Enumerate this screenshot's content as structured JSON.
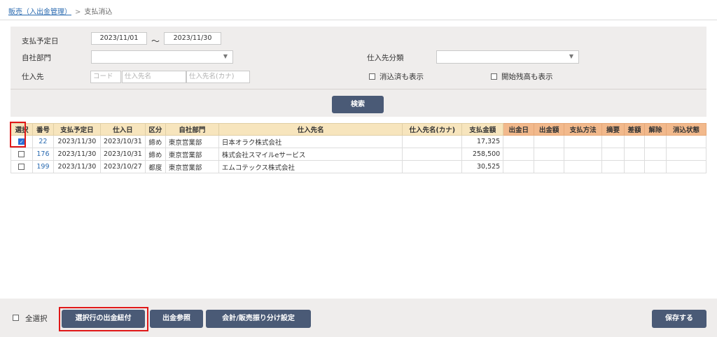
{
  "breadcrumb": {
    "parent": "販売（入出金管理）",
    "separator": ">",
    "current": "支払消込"
  },
  "search": {
    "due_date_label": "支払予定日",
    "date_from": "2023/11/01",
    "date_to": "2023/11/30",
    "tilde": "～",
    "department_label": "自社部門",
    "department_value": "",
    "supplier_class_label": "仕入先分類",
    "supplier_class_value": "",
    "supplier_label": "仕入先",
    "code_placeholder": "コード",
    "name_placeholder": "仕入先名",
    "kana_placeholder": "仕入先名(カナ)",
    "show_cleared_label": "消込済も表示",
    "show_opening_label": "開始残高も表示",
    "search_button": "検索"
  },
  "table": {
    "headers": {
      "select": "選択",
      "number": "番号",
      "due_date": "支払予定日",
      "purchase_date": "仕入日",
      "category": "区分",
      "department": "自社部門",
      "supplier": "仕入先名",
      "supplier_kana": "仕入先名(カナ)",
      "amount": "支払金額",
      "pay_date": "出金日",
      "pay_amount": "出金額",
      "pay_method": "支払方法",
      "memo": "摘要",
      "diff": "差額",
      "cancel": "解除",
      "status": "消込状態"
    },
    "rows": [
      {
        "checked": true,
        "number": "22",
        "due_date": "2023/11/30",
        "purchase_date": "2023/10/31",
        "category": "締め",
        "department": "東京営業部",
        "supplier": "日本オラク株式会社",
        "supplier_kana": "",
        "amount": "17,325"
      },
      {
        "checked": false,
        "number": "176",
        "due_date": "2023/11/30",
        "purchase_date": "2023/10/31",
        "category": "締め",
        "department": "東京営業部",
        "supplier": "株式会社スマイルeサービス",
        "supplier_kana": "",
        "amount": "258,500"
      },
      {
        "checked": false,
        "number": "199",
        "due_date": "2023/11/30",
        "purchase_date": "2023/10/27",
        "category": "都度",
        "department": "東京営業部",
        "supplier": "エムコテックス株式会社",
        "supplier_kana": "",
        "amount": "30,525"
      }
    ]
  },
  "footer": {
    "select_all_label": "全選択",
    "link_payment_button": "選択行の出金紐付",
    "view_payment_button": "出金参照",
    "accounting_button": "会計/販売振り分け設定",
    "save_button": "保存する"
  },
  "colors": {
    "button": "#4a5a76",
    "header_yellow": "#f7e5bd",
    "header_orange": "#f2b98c",
    "panel": "#efedec",
    "highlight": "#e01818",
    "link": "#2a6ab0"
  },
  "icons": {
    "dropdown": "caret-down-icon",
    "checked": "checkbox-checked-icon",
    "unchecked": "checkbox-icon"
  }
}
